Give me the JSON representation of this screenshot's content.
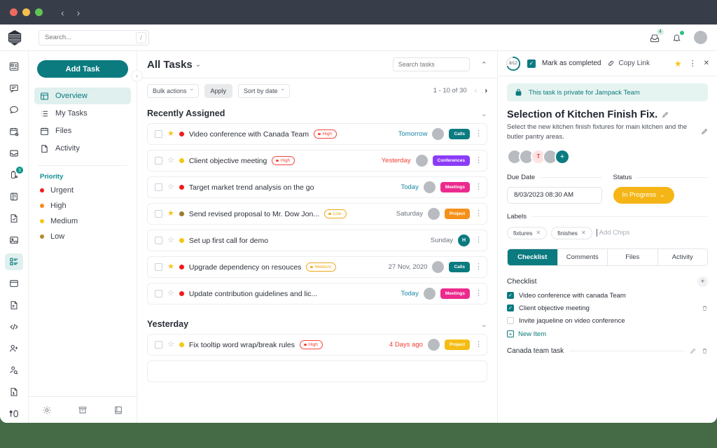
{
  "titlebar": {
    "back": "‹",
    "forward": "›"
  },
  "topbar": {
    "search_placeholder": "Search...",
    "search_value": "",
    "slash_key": "/",
    "inbox_badge": "4",
    "avatar_initials": ""
  },
  "sidebar": {
    "add_task_label": "Add Task",
    "collapse_label": "‹",
    "nav": [
      {
        "label": "Overview",
        "icon": "layout-icon",
        "active": true
      },
      {
        "label": "My Tasks",
        "icon": "list-icon",
        "active": false
      },
      {
        "label": "Files",
        "icon": "calendar-icon",
        "active": false
      },
      {
        "label": "Activity",
        "icon": "document-icon",
        "active": false
      }
    ],
    "priority_title": "Priority",
    "priorities": [
      {
        "label": "Urgent",
        "color": "#f01c1c"
      },
      {
        "label": "High",
        "color": "#f58a1f"
      },
      {
        "label": "Medium",
        "color": "#f5c518"
      },
      {
        "label": "Low",
        "color": "#b08a2e"
      }
    ],
    "footer_icons": [
      "gear-icon",
      "archive-icon",
      "book-icon"
    ]
  },
  "rail": {
    "items": [
      {
        "icon": "dashboard-icon",
        "badge": null,
        "active": false
      },
      {
        "icon": "message-square-icon",
        "badge": null,
        "active": false
      },
      {
        "icon": "chat-bubble-icon",
        "badge": null,
        "active": false
      },
      {
        "icon": "calendar-cancel-icon",
        "badge": null,
        "active": false
      },
      {
        "icon": "inbox-icon",
        "badge": null,
        "active": false
      },
      {
        "icon": "battery-icon",
        "badge": "3",
        "active": false
      },
      {
        "icon": "panel-icon",
        "badge": null,
        "active": false
      },
      {
        "icon": "file-check-icon",
        "badge": null,
        "active": false
      },
      {
        "icon": "image-icon",
        "badge": null,
        "active": false
      },
      {
        "icon": "tasks-icon",
        "badge": null,
        "active": true
      },
      {
        "icon": "window-icon",
        "badge": null,
        "active": false
      },
      {
        "icon": "file-text-icon",
        "badge": null,
        "active": false
      },
      {
        "icon": "code-icon",
        "badge": null,
        "active": false
      },
      {
        "icon": "user-add-icon",
        "badge": null,
        "active": false
      },
      {
        "icon": "user-search-icon",
        "badge": null,
        "active": false
      },
      {
        "icon": "file-info-icon",
        "badge": null,
        "active": false
      },
      {
        "icon": "widgets-icon",
        "badge": null,
        "active": false
      }
    ]
  },
  "main": {
    "page_title": "All Tasks",
    "title_caret": "⌄",
    "search_tasks_placeholder": "Search tasks",
    "search_tasks_value": "",
    "panel_toggle": "⌃",
    "toolbar": {
      "bulk_actions": "Bulk actions",
      "apply": "Apply",
      "sort_by": "Sort by date",
      "pagination": "1 - 10 of 30",
      "prev": "‹",
      "next": "›"
    },
    "groups": [
      {
        "name": "Recently Assigned",
        "collapse": "⌄",
        "tasks": [
          {
            "starred": true,
            "priority_color": "#f01c1c",
            "title": "Video conference with Canada Team",
            "badge": {
              "text": "High",
              "color": "#f4453c"
            },
            "date": "Tomorrow",
            "date_color": "#1a86a8",
            "avatar": "",
            "avatar_type": "grey",
            "tag": {
              "text": "Calls",
              "color": "#0b7b80"
            }
          },
          {
            "starred": false,
            "priority_color": "#f5c518",
            "title": "Client objective meeting",
            "badge": {
              "text": "High",
              "color": "#f4453c"
            },
            "date": "Yesterday",
            "date_color": "#f03c30",
            "avatar": "",
            "avatar_type": "grey",
            "tag": {
              "text": "Conferences",
              "color": "#8b3cf7"
            }
          },
          {
            "starred": false,
            "priority_color": "#f01c1c",
            "title": "Target market trend analysis on the go",
            "badge": null,
            "date": "Today",
            "date_color": "#1a86a8",
            "avatar": "",
            "avatar_type": "grey",
            "tag": {
              "text": "Meetings",
              "color": "#ec2a8e"
            }
          },
          {
            "starred": true,
            "priority_color": "#a07a2c",
            "title": "Send revised proposal to Mr. Dow Jon...",
            "badge": {
              "text": "Low",
              "color": "#f0a81c"
            },
            "date": "Saturday",
            "date_color": "#6a717b",
            "avatar": "",
            "avatar_type": "grey",
            "tag": {
              "text": "Project",
              "color": "#f5901a"
            }
          },
          {
            "starred": false,
            "priority_color": "#f5c518",
            "title": "Set up first call for demo",
            "badge": null,
            "date": "Sunday",
            "date_color": "#6a717b",
            "avatar": "H",
            "avatar_type": "teal",
            "tag": null
          },
          {
            "starred": true,
            "priority_color": "#f01c1c",
            "title": "Upgrade dependency on resouces",
            "badge": {
              "text": "Medium",
              "color": "#f0a81c"
            },
            "date": "27 Nov, 2020",
            "date_color": "#6a717b",
            "avatar": "",
            "avatar_type": "grey",
            "tag": {
              "text": "Calls",
              "color": "#0b7b80"
            }
          },
          {
            "starred": false,
            "priority_color": "#f01c1c",
            "title": "Update contribution guidelines and lic...",
            "badge": null,
            "date": "Today",
            "date_color": "#1a86a8",
            "avatar": "",
            "avatar_type": "grey",
            "tag": {
              "text": "Meetings",
              "color": "#ec2a8e"
            }
          }
        ]
      },
      {
        "name": "Yesterday",
        "collapse": "⌄",
        "tasks": [
          {
            "starred": false,
            "priority_color": "#f5c518",
            "title": "Fix tooltip word wrap/break rules",
            "badge": {
              "text": "High",
              "color": "#f4453c"
            },
            "date": "4 Days ago",
            "date_color": "#f03c30",
            "avatar": "",
            "avatar_type": "grey",
            "tag": {
              "text": "Project",
              "color": "#f5bc14"
            }
          }
        ]
      }
    ]
  },
  "detail": {
    "progress": "8/12",
    "progress_pct": 67,
    "mark_completed": "Mark as completed",
    "mark_completed_checked": true,
    "copy_link": "Copy Link",
    "star_icon": "★",
    "kebab_icon": "⋮",
    "close_icon": "✕",
    "private_notice": "This task is private for Jampack Team",
    "title": "Selection of Kitchen Finish Fix.",
    "description": "Select the new kitchen finish fixtures for main kitchen and the butler pantry areas.",
    "assignees": [
      {
        "initials": "",
        "type": "grey"
      },
      {
        "initials": "",
        "type": "grey"
      },
      {
        "initials": "T",
        "type": "pink"
      },
      {
        "initials": "",
        "type": "grey"
      },
      {
        "initials": "+",
        "type": "add"
      }
    ],
    "due_date_label": "Due Date",
    "due_date_value": "8/03/2023 08:30 AM",
    "status_label": "Status",
    "status_value": "In Progress",
    "status_color": "#f5b517",
    "labels_label": "Labels",
    "chips": [
      "fixtures",
      "finishes"
    ],
    "add_chips_placeholder": "Add Chips",
    "tabs": [
      {
        "label": "Checklist",
        "active": true
      },
      {
        "label": "Comments",
        "active": false
      },
      {
        "label": "Files",
        "active": false
      },
      {
        "label": "Activity",
        "active": false
      }
    ],
    "checklist_title": "Checklist",
    "checklist_add": "+",
    "checklist": [
      {
        "label": "Video conference with canada Team",
        "checked": true,
        "trash": false
      },
      {
        "label": "Client objective meeting",
        "checked": true,
        "trash": true
      },
      {
        "label": "Invite jaqueline on video conference",
        "checked": false,
        "trash": false
      }
    ],
    "new_item": "New Item",
    "sub_section": "Canada team task"
  },
  "colors": {
    "accent": "#0b7b80",
    "accent_light": "#dff0ee",
    "background": "#446b46",
    "titlebar": "#383d4a"
  }
}
